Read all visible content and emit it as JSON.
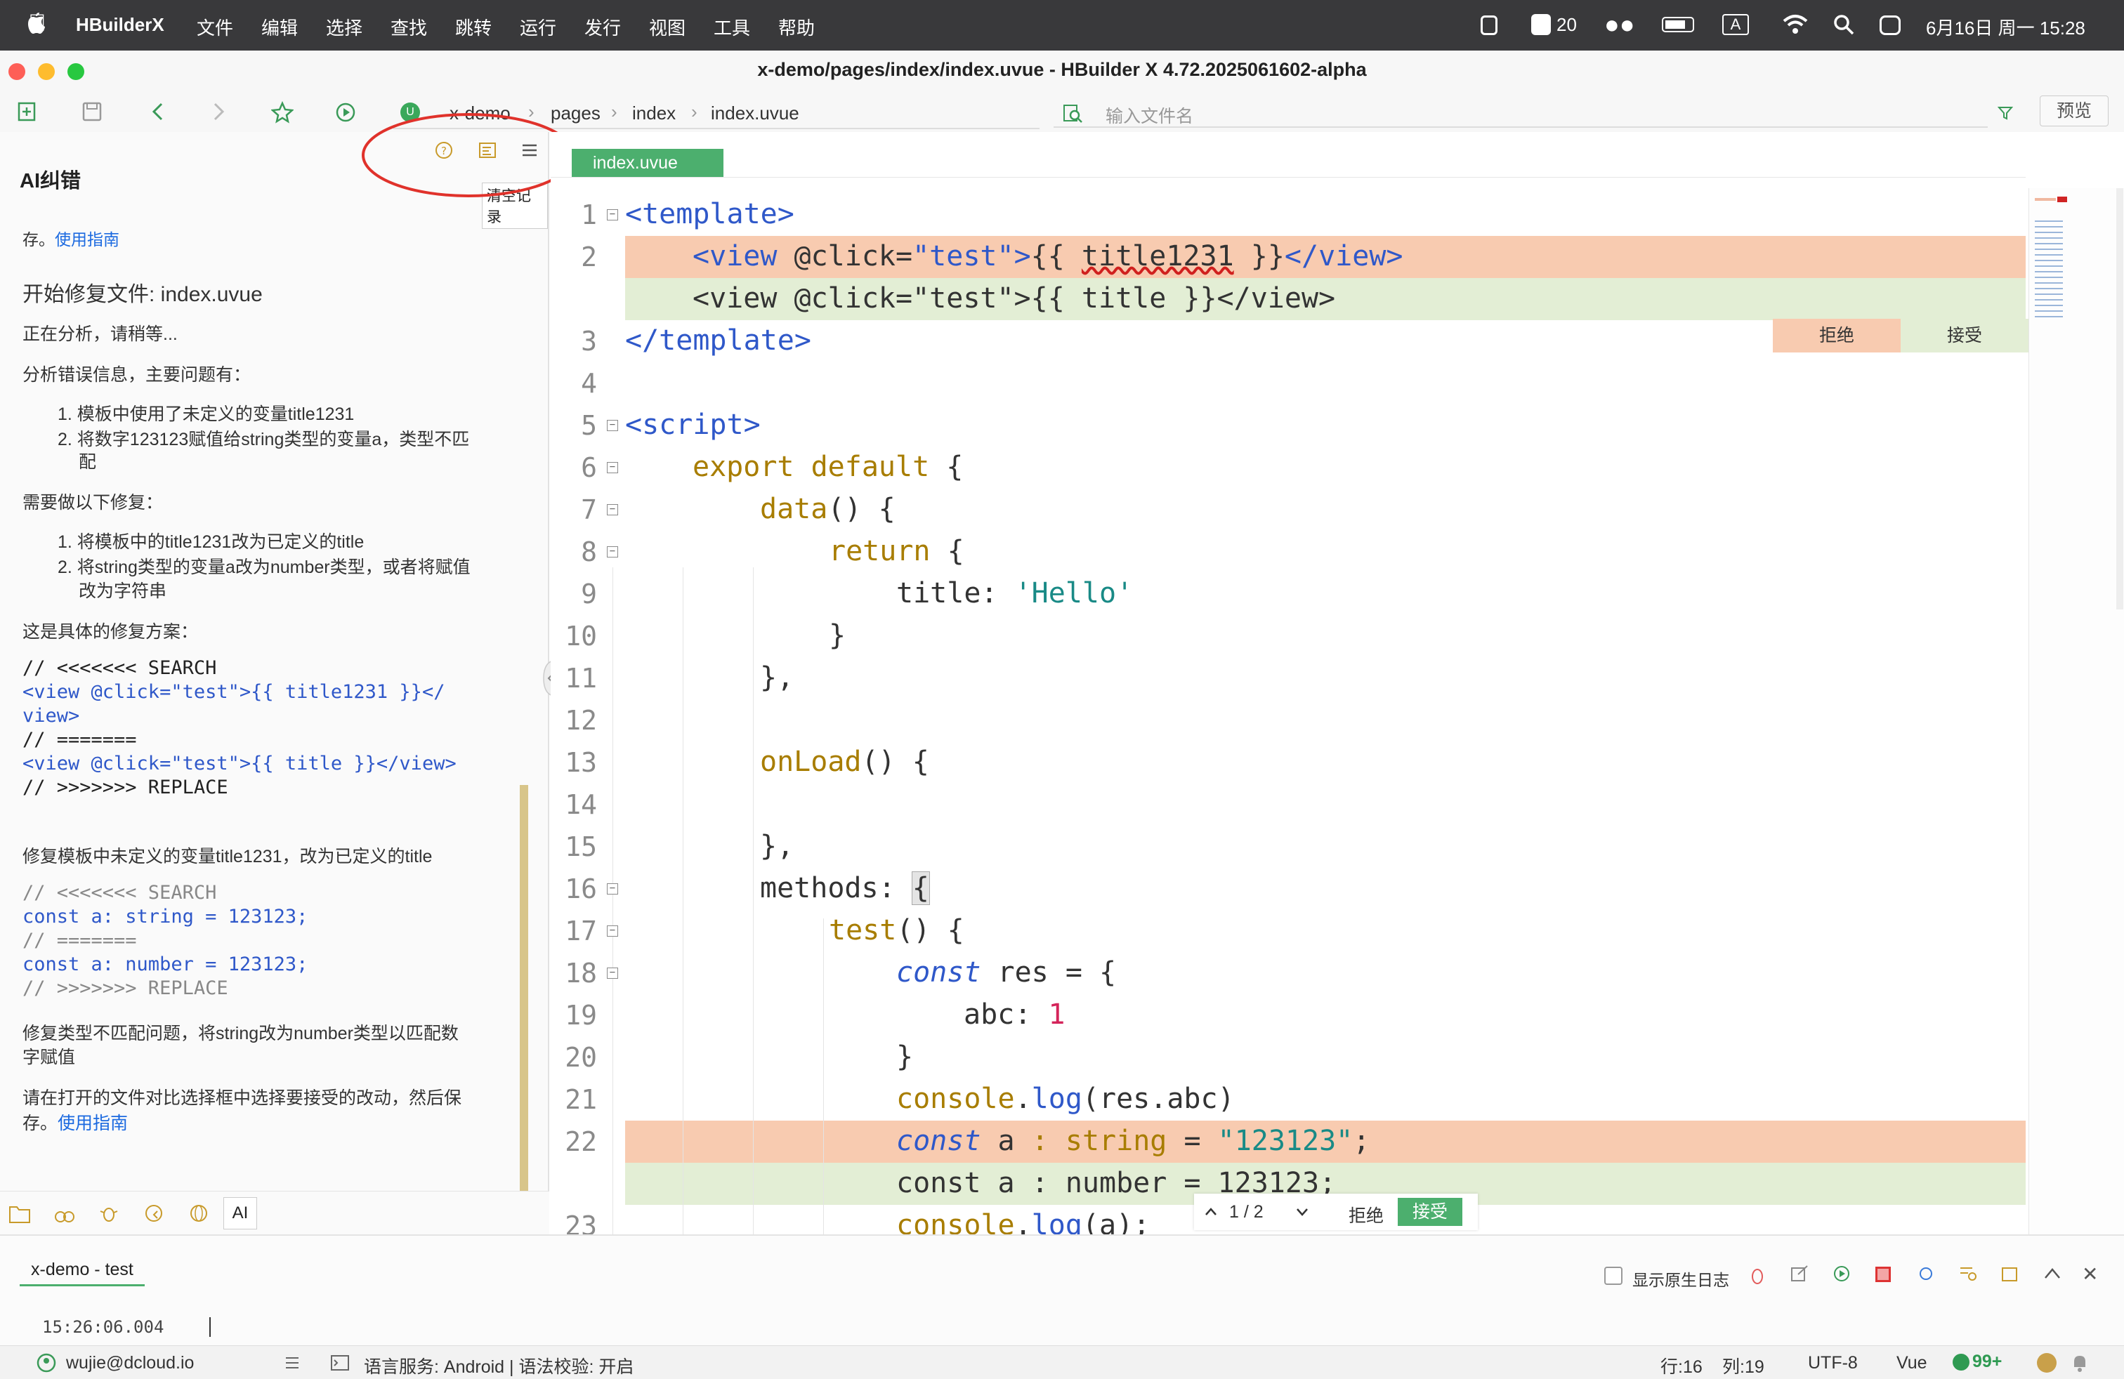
{
  "menubar": {
    "app_name": "HBuilderX",
    "items": [
      "文件",
      "编辑",
      "选择",
      "查找",
      "跳转",
      "运行",
      "发行",
      "视图",
      "工具",
      "帮助"
    ],
    "notification_count": "20",
    "datetime": "6月16日 周一  15:28"
  },
  "window": {
    "title": "x-demo/pages/index/index.uvue - HBuilder X 4.72.2025061602-alpha"
  },
  "toolbar": {
    "breadcrumb": [
      "x-demo",
      "pages",
      "index",
      "index.uvue"
    ],
    "file_search_placeholder": "输入文件名",
    "preview_label": "预览"
  },
  "sidebar": {
    "title": "AI纠错",
    "tooltip": "清空记录",
    "top_text": "存。",
    "top_link": "使用指南",
    "fixing_file": "开始修复文件: index.uvue",
    "analyzing": "正在分析，请稍等...",
    "analysis_intro": "分析错误信息，主要问题有：",
    "issues": [
      "1. 模板中使用了未定义的变量title1231",
      "2. 将数字123123赋值给string类型的变量a，类型不匹",
      "配"
    ],
    "todo_intro": "需要做以下修复：",
    "todos": [
      "1. 将模板中的title1231改为已定义的title",
      "2. 将string类型的变量a改为number类型，或者将赋值",
      "改为字符串"
    ],
    "plan_intro": "这是具体的修复方案：",
    "code1": [
      "// <<<<<<< SEARCH",
      "<view @click=\"test\">{{ title1231 }}</",
      "view>",
      "// =======",
      "<view @click=\"test\">{{ title }}</view>",
      "// >>>>>>> REPLACE"
    ],
    "fix1_desc": "修复模板中未定义的变量title1231，改为已定义的title",
    "code2": [
      "// <<<<<<< SEARCH",
      "const a: string = 123123;",
      "// =======",
      "const a: number = 123123;",
      "// >>>>>>> REPLACE"
    ],
    "fix2_desc_line1": "修复类型不匹配问题，将string改为number类型以匹配数",
    "fix2_desc_line2": "字赋值",
    "final_line1": "请在打开的文件对比选择框中选择要接受的改动，然后保",
    "final_line2": "存。",
    "final_link": "使用指南",
    "bottom_tab_ai": "AI"
  },
  "editor": {
    "tab_label": "index.uvue",
    "reject_label": "拒绝",
    "accept_label": "接受",
    "nav_counter": "1 / 2",
    "line_numbers": [
      "1",
      "2",
      "3",
      "4",
      "5",
      "6",
      "7",
      "8",
      "9",
      "10",
      "11",
      "12",
      "13",
      "14",
      "15",
      "16",
      "17",
      "18",
      "19",
      "20",
      "21",
      "22",
      "23"
    ]
  },
  "console": {
    "tab_label": "x-demo - test",
    "timestamp": "15:26:06.004",
    "show_native_log": "显示原生日志"
  },
  "statusbar": {
    "user": "wujie@dcloud.io",
    "language_service": "语言服务: Android | 语法校验: 开启",
    "row": "行:16",
    "col": "列:19",
    "encoding": "UTF-8",
    "language": "Vue",
    "badge": "99+"
  },
  "colors": {
    "accent_green": "#4caf6e",
    "diff_removed": "#f8cbb0",
    "diff_added": "#e3eed5",
    "annotation_red": "#e0322b"
  }
}
